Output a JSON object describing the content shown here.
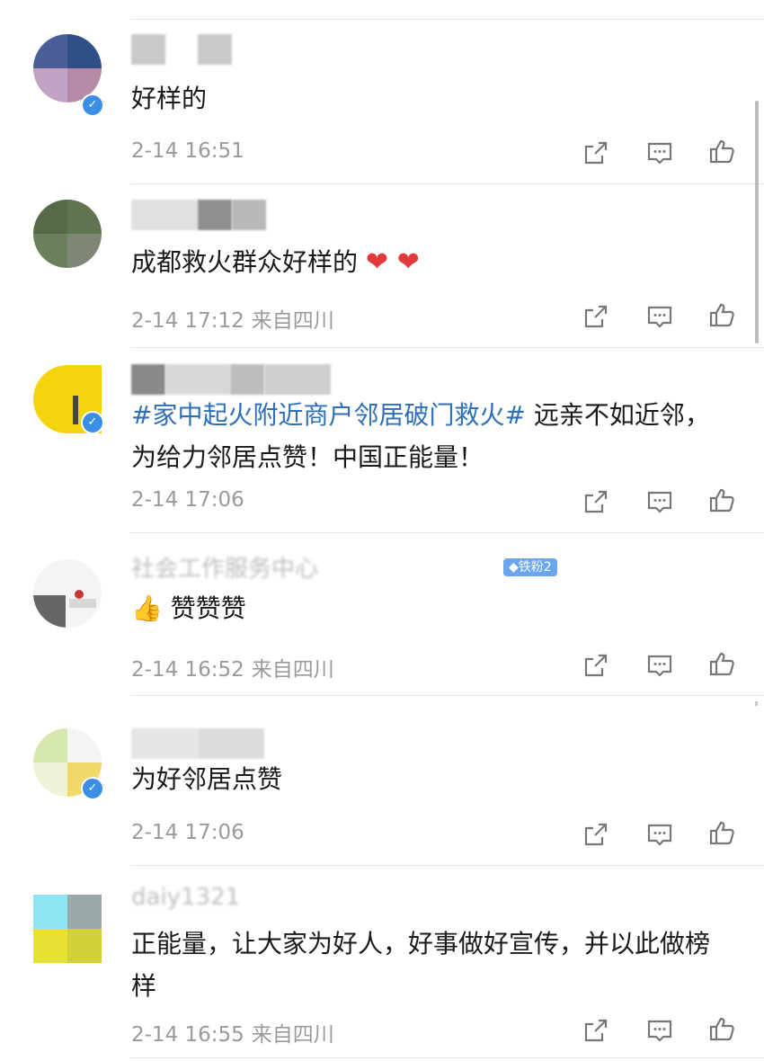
{
  "comments": [
    {
      "text": "好样的",
      "time": "2-14 16:51",
      "location": "",
      "verified": true
    },
    {
      "text": "成都救火群众好样的",
      "emoji": "❤ ❤",
      "time": "2-14 17:12",
      "location": "来自四川",
      "verified": false
    },
    {
      "topic": "#家中起火附近商户邻居破门救火#",
      "text": " 远亲不如近邻，为给力邻居点赞！中国正能量！",
      "time": "2-14 17:06",
      "location": "",
      "verified": true
    },
    {
      "username": "社会工作服务中心",
      "badge": "◆铁粉2",
      "emoji": "👍",
      "text": "赞赞赞",
      "time": "2-14 16:52",
      "location": "来自四川",
      "verified": false
    },
    {
      "text": "为好邻居点赞",
      "time": "2-14 17:06",
      "location": "",
      "verified": true
    },
    {
      "username": "daiy1321",
      "text": "正能量，让大家为好人，好事做好宣传，并以此做榜样",
      "time": "2-14 16:55",
      "location": "来自四川",
      "verified": false
    }
  ],
  "icons": {
    "share": "share-icon",
    "reply": "comment-icon",
    "like": "like-icon"
  },
  "colors": {
    "topic": "#2f6fb8",
    "verified": "#3b8ee6",
    "badge": "#6aa6ee"
  }
}
